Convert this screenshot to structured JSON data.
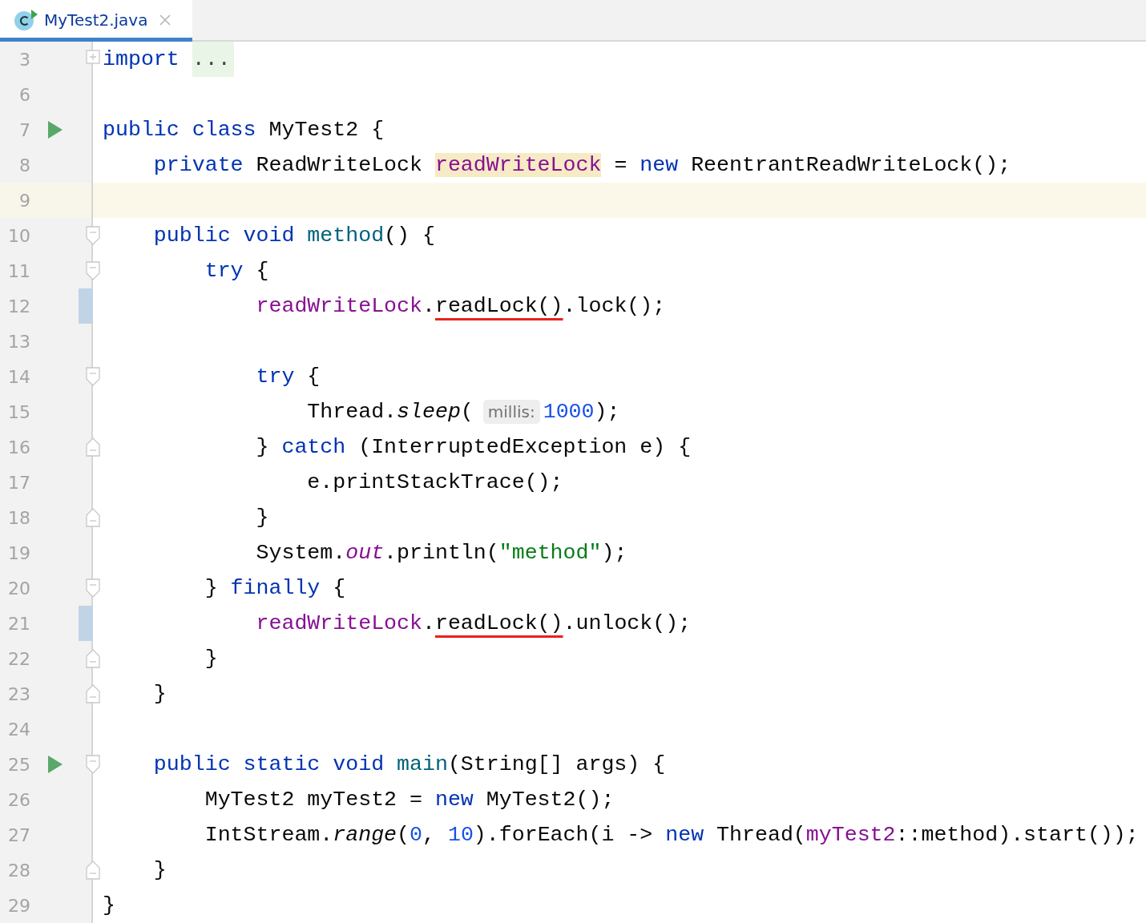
{
  "tabs": [
    {
      "label": "MyTest2.java",
      "selected": true
    }
  ],
  "lines": [
    {
      "number": "3",
      "runnable": false,
      "current": false,
      "changed": false,
      "fold": {
        "kind": "expand"
      },
      "tokens": [
        {
          "kind": "keyword",
          "text": "import"
        },
        {
          "kind": "folded",
          "text": "..."
        }
      ]
    },
    {
      "number": "6",
      "runnable": false,
      "current": false,
      "changed": false
    },
    {
      "number": "7",
      "runnable": true,
      "current": false,
      "changed": false,
      "tokens": [
        {
          "kind": "keyword",
          "text": "public class"
        },
        {
          "kind": "text",
          "text": " MyTest2 {"
        }
      ]
    },
    {
      "number": "8",
      "runnable": false,
      "current": false,
      "changed": false,
      "tokens": [
        {
          "kind": "keyword",
          "text": "    private"
        },
        {
          "kind": "text",
          "text": " ReadWriteLock "
        },
        {
          "kind": "field",
          "text": "readWriteLock",
          "highlighted": true
        },
        {
          "kind": "text",
          "text": " = "
        },
        {
          "kind": "keyword",
          "text": "new"
        },
        {
          "kind": "text",
          "text": " ReentrantReadWriteLock();"
        }
      ]
    },
    {
      "number": "9",
      "runnable": false,
      "current": true,
      "changed": false
    },
    {
      "number": "10",
      "runnable": false,
      "current": false,
      "changed": false,
      "fold": {
        "kind": "start"
      },
      "tokens": [
        {
          "kind": "keyword",
          "text": "    public void "
        },
        {
          "kind": "method",
          "text": "method"
        },
        {
          "kind": "text",
          "text": "() {"
        }
      ]
    },
    {
      "number": "11",
      "runnable": false,
      "current": false,
      "changed": false,
      "fold": {
        "kind": "start"
      },
      "tokens": [
        {
          "kind": "keyword",
          "text": "        try"
        },
        {
          "kind": "text",
          "text": " {"
        }
      ]
    },
    {
      "number": "12",
      "runnable": false,
      "current": false,
      "changed": true,
      "tokens": [
        {
          "kind": "field",
          "text": "            readWriteLock"
        },
        {
          "kind": "text",
          "text": "."
        },
        {
          "kind": "text",
          "text": "readLock()",
          "underlined": true
        },
        {
          "kind": "text",
          "text": ".lock();"
        }
      ]
    },
    {
      "number": "13",
      "runnable": false,
      "current": false,
      "changed": false
    },
    {
      "number": "14",
      "runnable": false,
      "current": false,
      "changed": false,
      "fold": {
        "kind": "start"
      },
      "tokens": [
        {
          "kind": "keyword",
          "text": "            try"
        },
        {
          "kind": "text",
          "text": " {"
        }
      ]
    },
    {
      "number": "15",
      "runnable": false,
      "current": false,
      "changed": false,
      "tokens": [
        {
          "kind": "text",
          "text": "                Thread."
        },
        {
          "kind": "static-method",
          "text": "sleep"
        },
        {
          "kind": "text",
          "text": "("
        },
        {
          "kind": "hint",
          "text": "millis:"
        },
        {
          "kind": "number",
          "text": "1000"
        },
        {
          "kind": "text",
          "text": ");"
        }
      ]
    },
    {
      "number": "16",
      "runnable": false,
      "current": false,
      "changed": false,
      "fold": {
        "kind": "end"
      },
      "tokens": [
        {
          "kind": "text",
          "text": "            } "
        },
        {
          "kind": "keyword",
          "text": "catch"
        },
        {
          "kind": "text",
          "text": " (InterruptedException e) {"
        }
      ]
    },
    {
      "number": "17",
      "runnable": false,
      "current": false,
      "changed": false,
      "tokens": [
        {
          "kind": "text",
          "text": "                e.printStackTrace();"
        }
      ]
    },
    {
      "number": "18",
      "runnable": false,
      "current": false,
      "changed": false,
      "fold": {
        "kind": "end"
      },
      "tokens": [
        {
          "kind": "text",
          "text": "            }"
        }
      ]
    },
    {
      "number": "19",
      "runnable": false,
      "current": false,
      "changed": false,
      "tokens": [
        {
          "kind": "text",
          "text": "            System."
        },
        {
          "kind": "static-field",
          "text": "out"
        },
        {
          "kind": "text",
          "text": ".println("
        },
        {
          "kind": "string",
          "text": "\"method\""
        },
        {
          "kind": "text",
          "text": ");"
        }
      ]
    },
    {
      "number": "20",
      "runnable": false,
      "current": false,
      "changed": false,
      "fold": {
        "kind": "start"
      },
      "tokens": [
        {
          "kind": "text",
          "text": "        } "
        },
        {
          "kind": "keyword",
          "text": "finally"
        },
        {
          "kind": "text",
          "text": " {"
        }
      ]
    },
    {
      "number": "21",
      "runnable": false,
      "current": false,
      "changed": true,
      "tokens": [
        {
          "kind": "field",
          "text": "            readWriteLock"
        },
        {
          "kind": "text",
          "text": "."
        },
        {
          "kind": "text",
          "text": "readLock()",
          "underlined": true
        },
        {
          "kind": "text",
          "text": ".unlock();"
        }
      ]
    },
    {
      "number": "22",
      "runnable": false,
      "current": false,
      "changed": false,
      "fold": {
        "kind": "end"
      },
      "tokens": [
        {
          "kind": "text",
          "text": "        }"
        }
      ]
    },
    {
      "number": "23",
      "runnable": false,
      "current": false,
      "changed": false,
      "fold": {
        "kind": "end"
      },
      "tokens": [
        {
          "kind": "text",
          "text": "    }"
        }
      ]
    },
    {
      "number": "24",
      "runnable": false,
      "current": false,
      "changed": false
    },
    {
      "number": "25",
      "runnable": true,
      "current": false,
      "changed": false,
      "fold": {
        "kind": "start"
      },
      "tokens": [
        {
          "kind": "keyword",
          "text": "    public static void "
        },
        {
          "kind": "method",
          "text": "main"
        },
        {
          "kind": "text",
          "text": "(String[] args) {"
        }
      ]
    },
    {
      "number": "26",
      "runnable": false,
      "current": false,
      "changed": false,
      "tokens": [
        {
          "kind": "text",
          "text": "        MyTest2 myTest2 = "
        },
        {
          "kind": "keyword",
          "text": "new"
        },
        {
          "kind": "text",
          "text": " MyTest2();"
        }
      ]
    },
    {
      "number": "27",
      "runnable": false,
      "current": false,
      "changed": false,
      "tokens": [
        {
          "kind": "text",
          "text": "        IntStream."
        },
        {
          "kind": "static-method",
          "text": "range"
        },
        {
          "kind": "text",
          "text": "("
        },
        {
          "kind": "number",
          "text": "0"
        },
        {
          "kind": "text",
          "text": ", "
        },
        {
          "kind": "number",
          "text": "10"
        },
        {
          "kind": "text",
          "text": ").forEach(i -> "
        },
        {
          "kind": "keyword",
          "text": "new"
        },
        {
          "kind": "text",
          "text": " Thread("
        },
        {
          "kind": "field",
          "text": "myTest2"
        },
        {
          "kind": "text",
          "text": "::method).start());"
        }
      ]
    },
    {
      "number": "28",
      "runnable": false,
      "current": false,
      "changed": false,
      "fold": {
        "kind": "end"
      },
      "tokens": [
        {
          "kind": "text",
          "text": "    }"
        }
      ]
    },
    {
      "number": "29",
      "runnable": false,
      "current": false,
      "changed": false,
      "tokens": [
        {
          "kind": "text",
          "text": "}"
        }
      ]
    }
  ]
}
